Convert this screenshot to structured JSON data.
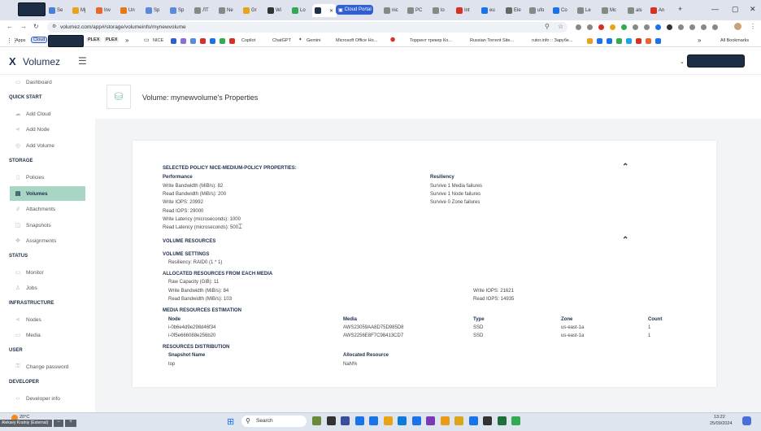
{
  "browser": {
    "tabs": [
      {
        "label": "",
        "color": "#1d2d44"
      },
      {
        "label": "Se",
        "color": "#4a7fd9"
      },
      {
        "label": "Mj",
        "color": "#e8a317"
      },
      {
        "label": "Inv",
        "color": "#e8682a"
      },
      {
        "label": "Un",
        "color": "#e87817"
      },
      {
        "label": "Sp",
        "color": "#5a8ad9"
      },
      {
        "label": "Sp",
        "color": "#5a8ad9"
      },
      {
        "label": "ЛТ",
        "color": "#888888"
      },
      {
        "label": "Ne",
        "color": "#888888"
      },
      {
        "label": "Gr",
        "color": "#e8a317"
      },
      {
        "label": "Wi",
        "color": "#333333"
      },
      {
        "label": "Lo",
        "color": "#35a852"
      },
      {
        "label": "",
        "color": "#1e2f4a"
      },
      {
        "label": "nic",
        "color": "#888888"
      },
      {
        "label": "PC",
        "color": "#888888"
      },
      {
        "label": "lo",
        "color": "#888888"
      },
      {
        "label": "Int",
        "color": "#d93025"
      },
      {
        "label": "eu",
        "color": "#1a73e8"
      },
      {
        "label": "Ele",
        "color": "#666666"
      },
      {
        "label": "ufo",
        "color": "#888888"
      },
      {
        "label": "Co",
        "color": "#1a73e8"
      },
      {
        "label": "Le",
        "color": "#888888"
      },
      {
        "label": "Mc",
        "color": "#888888"
      },
      {
        "label": "als",
        "color": "#888888"
      },
      {
        "label": "An",
        "color": "#d93025"
      }
    ],
    "cloud_portal_tab": "Cloud Portal",
    "url": "volumez.com/app#/storage/volumeinfo/mynewvolume",
    "bookmarks": {
      "apps": "Apps",
      "cloud": "Cloud",
      "plex1": "PLEX",
      "plex2": "PLEX",
      "nice": "NICE",
      "copilot": "Copilot",
      "chatgpt": "ChatGPT",
      "gemini": "Gemini",
      "microsoft": "Microsoft Office Ho...",
      "torrent": "Торрент трекер Ко...",
      "russian": "Russian Torrent Site...",
      "rutor": "rutor.info :: Зарубе...",
      "all": "All Bookmarks"
    }
  },
  "app": {
    "brand": "Volumez",
    "sidebar": {
      "dashboard": "Dashboard",
      "quick_start": "QUICK START",
      "add_cloud": "Add Cloud",
      "add_node": "Add Node",
      "add_volume": "Add Volume",
      "storage": "STORAGE",
      "policies": "Policies",
      "volumes": "Volumes",
      "attachments": "Attachments",
      "snapshots": "Snapshots",
      "assignments": "Assignments",
      "status": "STATUS",
      "monitor": "Monitor",
      "jobs": "Jobs",
      "infrastructure": "INFRASTRUCTURE",
      "nodes": "Nodes",
      "media": "Media",
      "user": "USER",
      "change_password": "Change password",
      "developer": "DEVELOPER",
      "developer_info": "Developer info"
    },
    "page_title": "Volume: mynewvolume's Properties",
    "policy": {
      "heading": "SELECTED POLICY NICE-MEDIUM-POLICY PROPERTIES:",
      "performance_label": "Performance",
      "write_bw": "Write Bandwidth (MiB/s): 82",
      "read_bw": "Read Bandwidth (MiB/s): 200",
      "write_iops": "Write IOPS: 20992",
      "read_iops": "Read IOPS: 29000",
      "write_lat": "Write Latency (microseconds): 1000",
      "read_lat": "Read Latency (microseconds): 500",
      "resiliency_label": "Resiliency",
      "media_fail": "Survive 1 Media failures",
      "node_fail": "Survive 1 Node failures",
      "zone_fail": "Survive 0 Zone failures"
    },
    "resources": {
      "heading": "VOLUME RESOURCES",
      "settings_heading": "VOLUME SETTINGS",
      "resiliency": "Resiliency: RAID0 (1 * 1)",
      "allocated_heading": "ALLOCATED RESOURCES FROM EACH MEDIA",
      "raw_capacity": "Raw Capacity (GiB): 11",
      "write_bw": "Write Bandwidth (MiB/s): 84",
      "read_bw": "Read Bandwidth (MiB/s): 103",
      "write_iops": "Write IOPS: 21621",
      "read_iops": "Read IOPS: 14935",
      "estimation_heading": "MEDIA RESOURCES ESTIMATION",
      "columns": {
        "node": "Node",
        "media": "Media",
        "type": "Type",
        "zone": "Zone",
        "count": "Count"
      },
      "rows": [
        {
          "node": "i-0b6e4d9e298d46f34",
          "media": "AWS23059AA8D75D985D8",
          "type": "SSD",
          "zone": "us-east-1a",
          "count": "1"
        },
        {
          "node": "i-0f5e666088e256b20",
          "media": "AWS2256E8F7C98413CD7",
          "type": "SSD",
          "zone": "us-east-1a",
          "count": "1"
        }
      ],
      "distribution_heading": "RESOURCES DISTRIBUTION",
      "snapshot_col": "Snapshot Name",
      "allocated_col": "Allocated Resource",
      "snapshot_name": "top",
      "allocated_value": "NaN%"
    }
  },
  "taskbar": {
    "search": "Search",
    "weather": "20°C",
    "user": "Aleksey Krainiy (External)",
    "time": "13:22",
    "date": "25/09/2024"
  }
}
